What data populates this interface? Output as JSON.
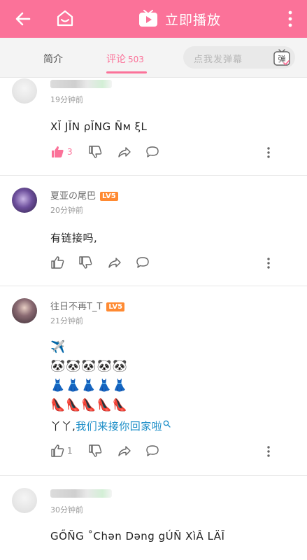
{
  "header": {
    "play_label": "立即播放",
    "colors": {
      "brand": "#fb7299"
    }
  },
  "tabs": {
    "intro": "简介",
    "comments": "评论",
    "comments_count": "503",
    "danmaku_placeholder": "点我发弹幕",
    "danmaku_button": "弹"
  },
  "comments": [
    {
      "time": "19分钟前",
      "text": "XĬ  JĬN  ρĬNG  Ñм ξL",
      "likes": "3",
      "liked": true
    },
    {
      "username": "夏亚の尾巴",
      "level": "LV5",
      "time": "20分钟前",
      "text": "有链接吗,"
    },
    {
      "username": "往日不再T_T",
      "level": "LV5",
      "time": "21分钟前",
      "lines": [
        "✈️",
        "🐼🐼🐼🐼🐼",
        "👗👗👗👗👗",
        "👠👠👠👠👠"
      ],
      "text_prefix": "丫丫,",
      "text_link": "我们来接你回家啦",
      "likes": "1"
    },
    {
      "time": "30分钟前",
      "text": "GŐÑG ˚Chən Dəng gÚÑ  XìÂ  LÄĪ"
    }
  ]
}
